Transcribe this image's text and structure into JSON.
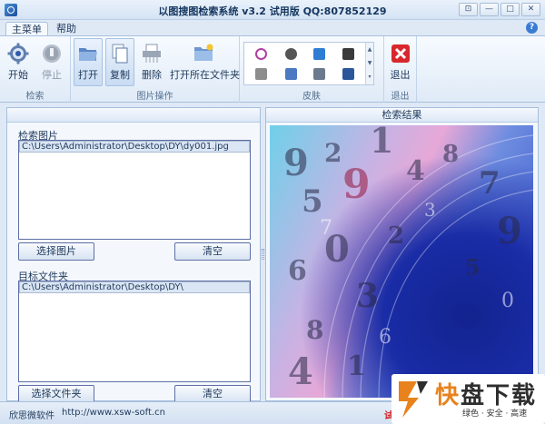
{
  "window": {
    "title": "以图搜图检索系统 v3.2 试用版   QQ:807852129",
    "controls": [
      "⊡",
      "—",
      "□",
      "✕"
    ]
  },
  "tabs": [
    {
      "label": "主菜单"
    },
    {
      "label": "帮助"
    }
  ],
  "ribbon": {
    "search_group": {
      "label": "检索",
      "start": "开始",
      "stop": "停止"
    },
    "image_group": {
      "label": "图片操作",
      "open": "打开",
      "copy": "复制",
      "delete": "删除",
      "open_folder": "打开所在文件夹"
    },
    "skin_group": {
      "label": "皮肤"
    },
    "exit_group": {
      "label": "退出",
      "exit": "退出"
    }
  },
  "left_panel": {
    "search_image": {
      "label": "检索图片",
      "items": [
        "C:\\Users\\Administrator\\Desktop\\DY\\dy001.jpg"
      ],
      "select_button": "选择图片",
      "clear_button": "清空"
    },
    "target_folder": {
      "label": "目标文件夹",
      "items": [
        "C:\\Users\\Administrator\\Desktop\\DY\\"
      ],
      "select_button": "选择文件夹",
      "clear_button": "清空"
    }
  },
  "right_panel": {
    "title": "检索结果"
  },
  "statusbar": {
    "company": "欣思微软件",
    "url": "http://www.xsw-soft.cn",
    "trial": "试"
  },
  "watermark": {
    "brand_orange": "快",
    "brand_dark": "盘下载",
    "tagline": "绿色 · 安全 · 高速"
  },
  "colors": {
    "accent": "#1e395b",
    "panel_border": "#a6bedb",
    "button_border": "#5f6fa5",
    "watermark_orange": "#e8821c",
    "status_red": "#d21414"
  }
}
